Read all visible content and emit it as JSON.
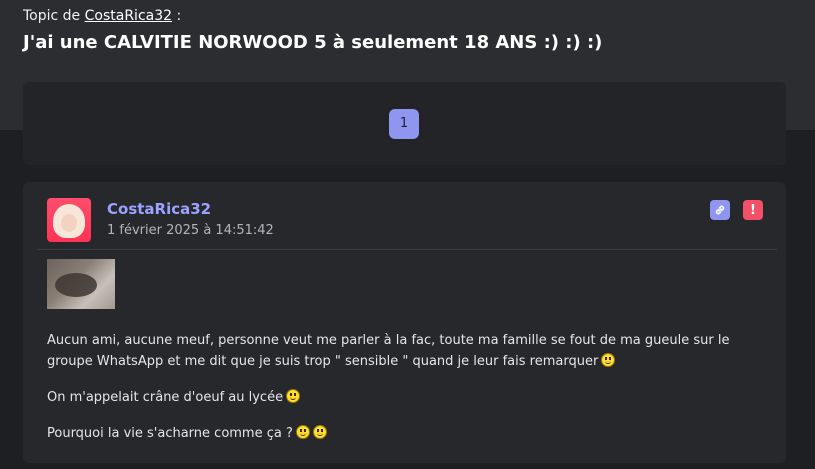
{
  "topic": {
    "prefix": "Topic de",
    "author_link": "CostaRica32",
    "suffix": ":",
    "title": "J'ai une CALVITIE NORWOOD 5 à seulement 18 ANS :) :) :)"
  },
  "pagination": {
    "pages": [
      "1"
    ],
    "current": "1"
  },
  "post": {
    "author": "CostaRica32",
    "date": "1 février 2025 à 14:51:42",
    "paragraphs": [
      "Aucun ami, aucune meuf, personne veut me parler à la fac, toute ma famille se fout de ma gueule sur le groupe WhatsApp et me dit que je suis trop \" sensible \" quand je leur fais remarquer",
      "On m'appelait crâne d'oeuf au lycée",
      "Pourquoi la vie s'acharne comme ça ?"
    ],
    "icons": {
      "link": "link-icon",
      "report": "alert-icon",
      "smiley": "smiley-icon"
    },
    "report_label": "!"
  },
  "colors": {
    "accent": "#8f96f0",
    "author": "#9aa3ff",
    "report": "#f24f68",
    "background": "#1e1f23",
    "card": "#27282c"
  }
}
